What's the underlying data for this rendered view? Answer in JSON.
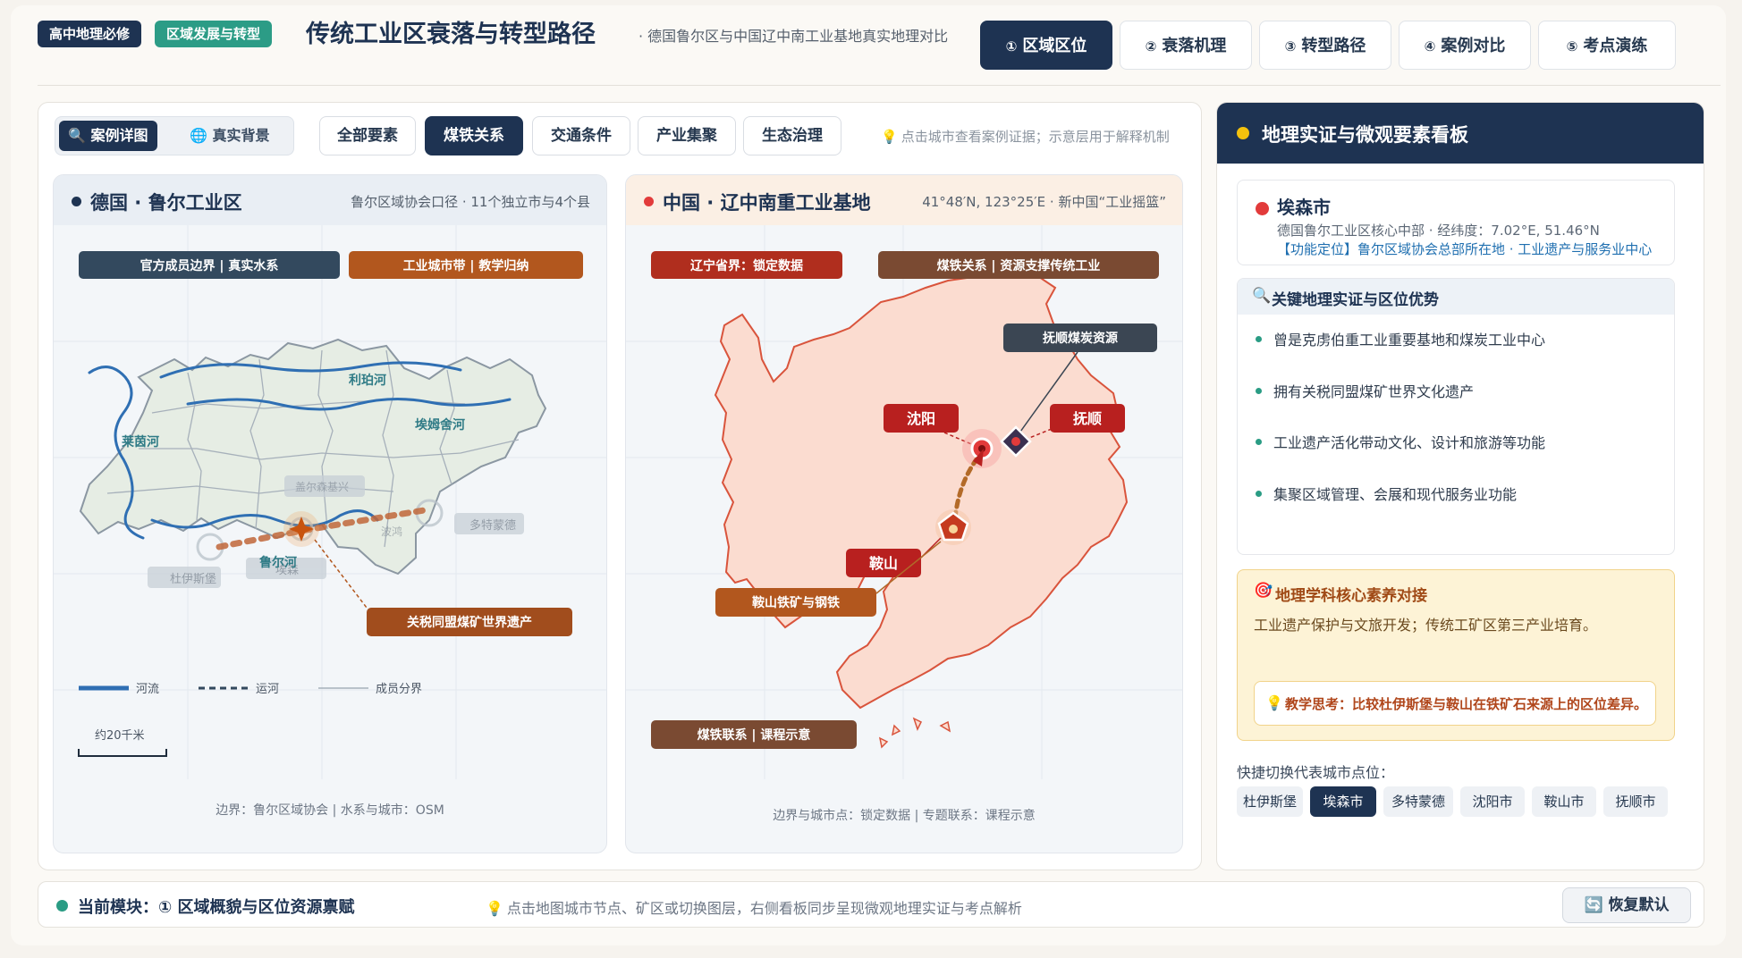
{
  "header": {
    "badge_course": "高中地理必修",
    "badge_unit": "区域发展与转型",
    "title": "传统工业区衰落与转型路径",
    "subtitle": "· 德国鲁尔区与中国辽中南工业基地真实地理对比",
    "tabs": [
      {
        "num": "①",
        "label": "区域区位",
        "active": true
      },
      {
        "num": "②",
        "label": "衰落机理",
        "active": false
      },
      {
        "num": "③",
        "label": "转型路径",
        "active": false
      },
      {
        "num": "④",
        "label": "案例对比",
        "active": false
      },
      {
        "num": "⑤",
        "label": "考点演练",
        "active": false
      }
    ]
  },
  "toolbar": {
    "view_case": "案例详图",
    "view_real": "真实背景",
    "filters": [
      "全部要素",
      "煤铁关系",
      "交通条件",
      "产业集聚",
      "生态治理"
    ],
    "active_filter": "煤铁关系",
    "hint": "点击城市查看案例证据；示意层用于解释机制"
  },
  "ruhr": {
    "title": "德国 · 鲁尔工业区",
    "subtitle": "鲁尔区域协会口径 · 11个独立市与4个县",
    "dot_color": "#1e3352",
    "tag_boundary": "官方成员边界 | 真实水系",
    "tag_cities": "工业城市带 | 教学归纳",
    "callout": "关税同盟煤矿世界遗产",
    "rivers": [
      "利珀河",
      "埃姆舍河",
      "莱茵河",
      "鲁尔河"
    ],
    "faded_cities": [
      "杜伊斯堡",
      "埃森",
      "多特蒙德",
      "盖尔森基兴",
      "波鸿"
    ],
    "legend": [
      "河流",
      "运河",
      "成员分界"
    ],
    "scale": "约20千米",
    "footer": "边界：鲁尔区域协会 | 水系与城市：OSM",
    "colors": {
      "river": "#2f6fb3",
      "land": "#e7eee5",
      "corridor": "#c0663a",
      "tag_dark": "#33495e",
      "tag_orange": "#b2571e"
    }
  },
  "liaoning": {
    "title": "中国 · 辽中南重工业基地",
    "subtitle": "41°48′N, 123°25′E · 新中国“工业摇篮”",
    "dot_color": "#e23b3b",
    "tag_province": "辽宁省界：锁定数据",
    "tag_resource": "煤铁关系 | 资源支撑传统工业",
    "city_shenyang": "沈阳",
    "city_fushun": "抚顺",
    "city_anshan": "鞍山",
    "callout_coal": "抚顺煤炭资源",
    "callout_iron": "鞍山铁矿与钢铁",
    "tag_link": "煤铁联系 | 课程示意",
    "footer": "边界与城市点：锁定数据 | 专题联系：课程示意",
    "colors": {
      "land": "#fbdcd0",
      "border": "#d9543c",
      "red": "#b8201f",
      "brown": "#7a4a32"
    }
  },
  "panel": {
    "title": "地理实证与微观要素看板",
    "city": {
      "name": "埃森市",
      "coord": "德国鲁尔工业区核心中部 · 经纬度：7.02°E, 51.46°N",
      "func": "【功能定位】鲁尔区域协会总部所在地 · 工业遗产与服务业中心"
    },
    "evidence_title": "关键地理实证与区位优势",
    "evidence": [
      "曾是克虏伯重工业重要基地和煤炭工业中心",
      "拥有关税同盟煤矿世界文化遗产",
      "工业遗产活化带动文化、设计和旅游等功能",
      "集聚区域管理、会展和现代服务业功能"
    ],
    "core_title": "地理学科核心素养对接",
    "core_body": "工业遗产保护与文旅开发；传统工矿区第三产业培育。",
    "think": "教学思考：比较杜伊斯堡与鞍山在铁矿石来源上的区位差异。",
    "quick_label": "快捷切换代表城市点位：",
    "quick_cities": [
      "杜伊斯堡",
      "埃森市",
      "多特蒙德",
      "沈阳市",
      "鞍山市",
      "抚顺市"
    ],
    "quick_active": "埃森市"
  },
  "status": {
    "module": "当前模块：① 区域概貌与区位资源禀赋",
    "tip": "点击地图城市节点、矿区或切换图层，右侧看板同步呈现微观地理实证与考点解析",
    "reset": "恢复默认"
  }
}
